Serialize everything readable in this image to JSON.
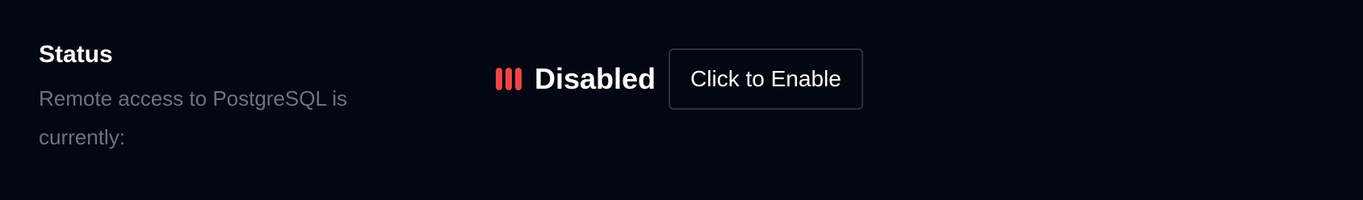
{
  "status": {
    "title": "Status",
    "description": "Remote access to PostgreSQL is currently:",
    "state_label": "Disabled",
    "state_color": "#ef4444",
    "indicator_icon": "status-bars-icon",
    "action_label": "Click to Enable"
  },
  "theme": {
    "background": "#030712",
    "muted_text": "#6b7280",
    "button_border": "#2a2f3b"
  }
}
